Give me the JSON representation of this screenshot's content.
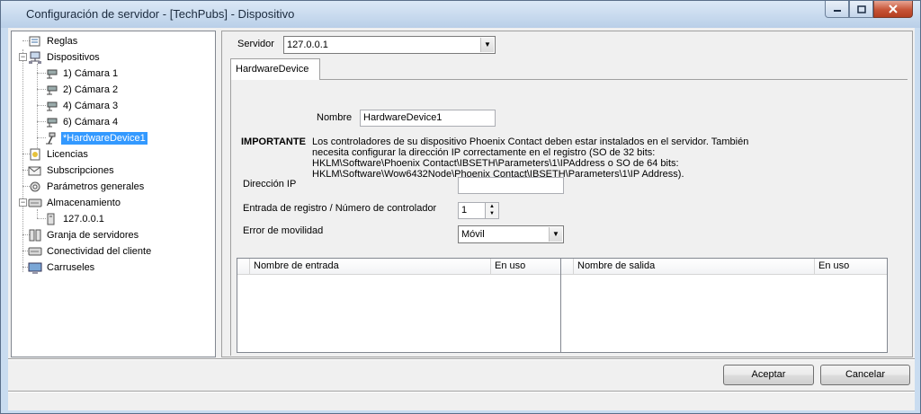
{
  "window": {
    "title": "Configuración de servidor - [TechPubs] - Dispositivo",
    "minimize": "0",
    "maximize": "1",
    "close": "x"
  },
  "tree": {
    "items": [
      {
        "label": "Reglas",
        "icon": "rules-icon"
      },
      {
        "label": "Dispositivos",
        "icon": "devices-icon"
      },
      {
        "label": "1) Cámara 1",
        "icon": "camera-icon"
      },
      {
        "label": "2) Cámara 2",
        "icon": "camera-icon"
      },
      {
        "label": "4) Cámara 3",
        "icon": "camera-icon"
      },
      {
        "label": "6) Cámara 4",
        "icon": "camera-icon"
      },
      {
        "label": "*HardwareDevice1",
        "icon": "hardware-device-icon"
      },
      {
        "label": "Licencias",
        "icon": "license-icon"
      },
      {
        "label": "Subscripciones",
        "icon": "subscriptions-icon"
      },
      {
        "label": "Parámetros generales",
        "icon": "settings-icon"
      },
      {
        "label": "Almacenamiento",
        "icon": "storage-icon"
      },
      {
        "label": "127.0.0.1",
        "icon": "server-icon"
      },
      {
        "label": "Granja de servidores",
        "icon": "server-farm-icon"
      },
      {
        "label": "Conectividad del cliente",
        "icon": "client-connectivity-icon"
      },
      {
        "label": "Carruseles",
        "icon": "carousel-icon"
      }
    ]
  },
  "server": {
    "label": "Servidor",
    "value": "127.0.0.1"
  },
  "tab": {
    "label": "HardwareDevice"
  },
  "form": {
    "name_label": "Nombre",
    "name_value": "HardwareDevice1",
    "important_label": "IMPORTANTE",
    "important_text_1": "Los controladores de su dispositivo Phoenix Contact deben estar instalados en el servidor. También",
    "important_text_2": "necesita configurar la dirección IP correctamente en el registro (SO de 32 bits:",
    "important_text_3": "HKLM\\Software\\Phoenix Contact\\IBSETH\\Parameters\\1\\IPAddress o SO de 64 bits:",
    "important_text_4": "HKLM\\Software\\Wow6432Node\\Phoenix Contact\\IBSETH\\Parameters\\1\\IP Address).",
    "ip_label": "Dirección IP",
    "ip_value": "",
    "register_label": "Entrada de registro / Número de controlador",
    "register_value": "1",
    "mobility_label": "Error de movilidad",
    "mobility_value": "Móvil"
  },
  "inputs_table": {
    "col_name": "Nombre de entrada",
    "col_inuse": "En uso"
  },
  "outputs_table": {
    "col_name": "Nombre de salida",
    "col_inuse": "En uso"
  },
  "buttons": {
    "accept": "Aceptar",
    "cancel": "Cancelar"
  }
}
